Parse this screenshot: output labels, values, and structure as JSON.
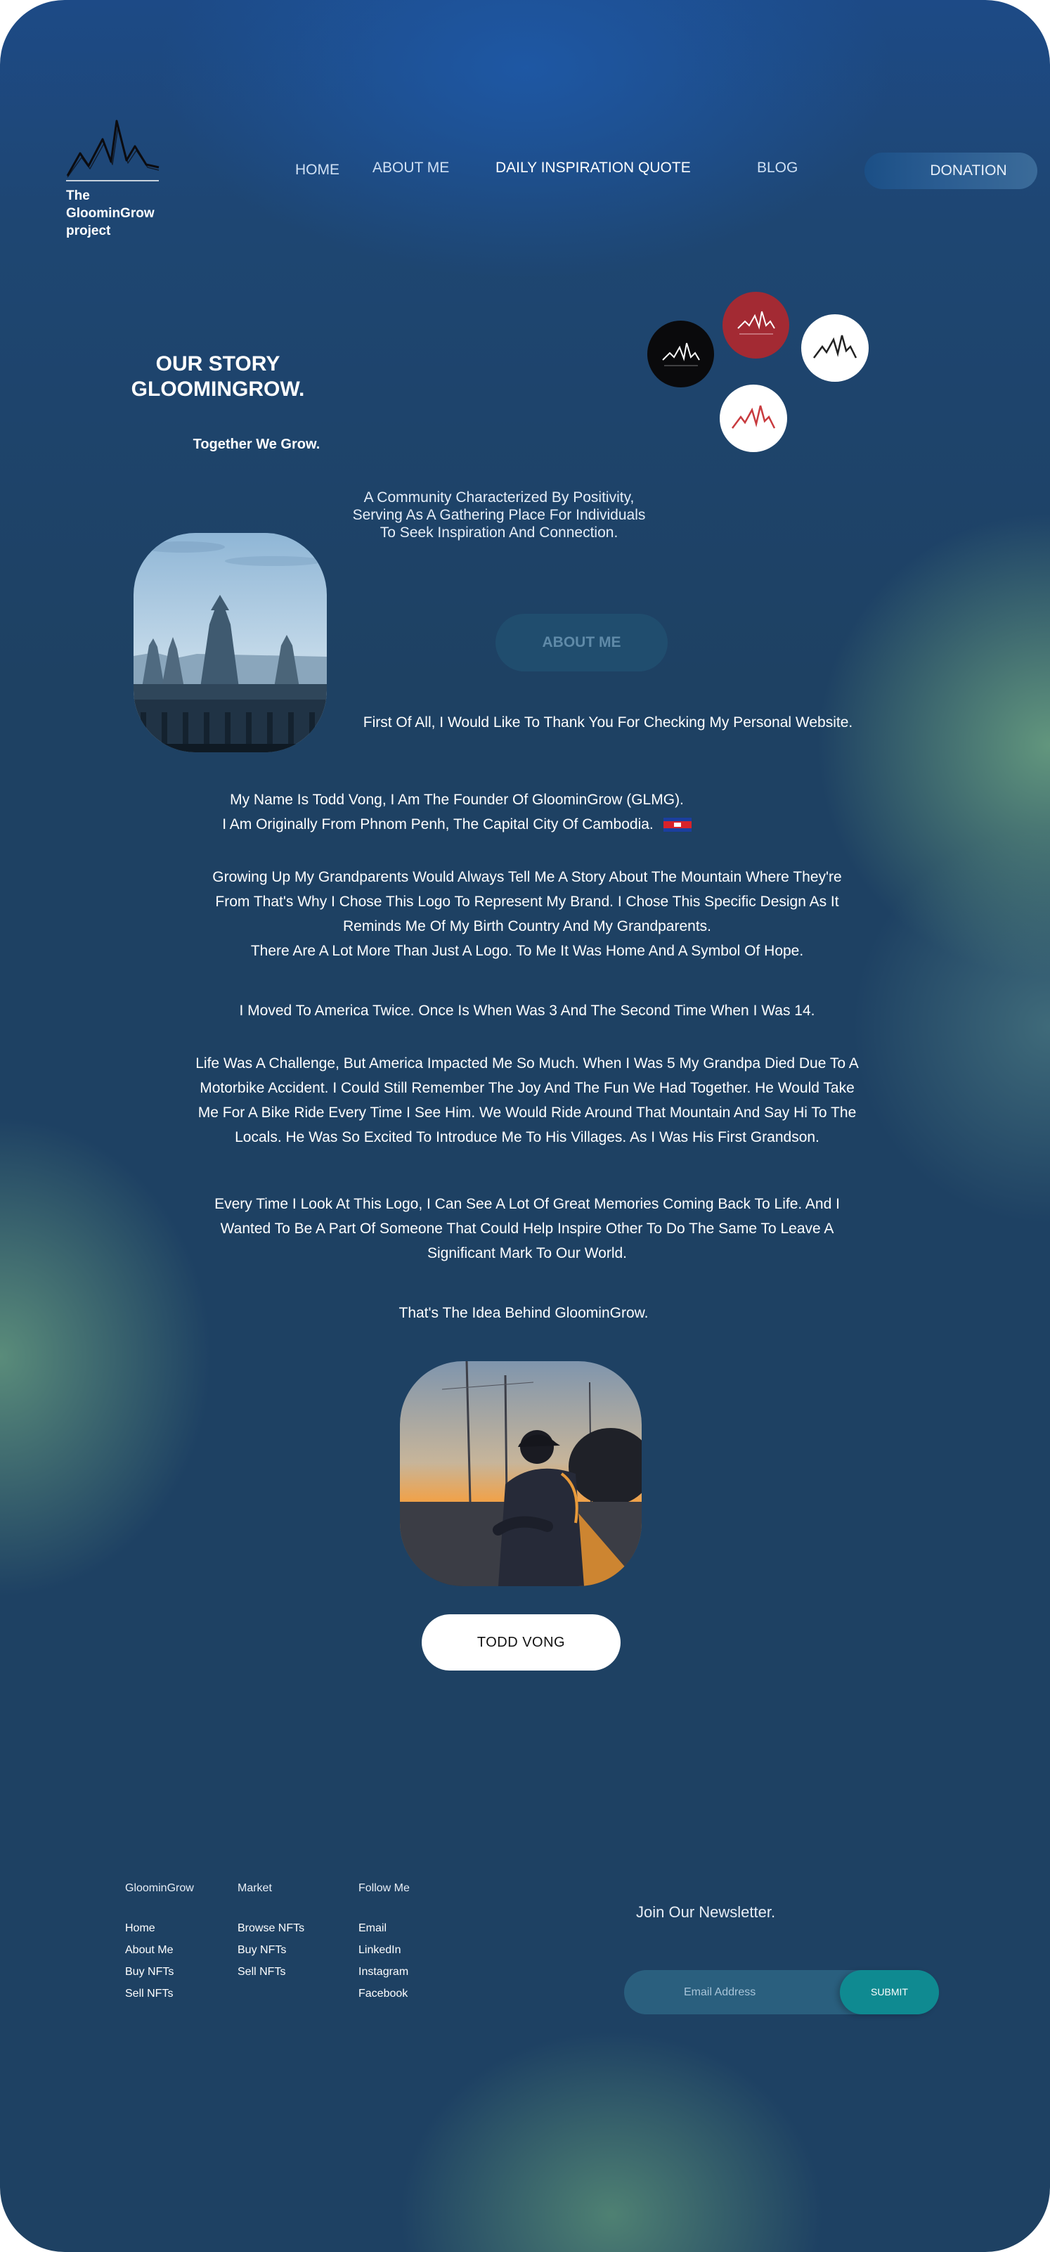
{
  "brand": {
    "logo_text": "The GloominGrow project",
    "logo_icon": "mountain-icon"
  },
  "nav": {
    "home": "HOME",
    "about": "ABOUT ME",
    "quote": "DAILY INSPIRATION QUOTE",
    "blog": "BLOG",
    "donation": "DONATION"
  },
  "hero": {
    "title_line1": "OUR STORY",
    "title_line2": "GLOOMINGROW.",
    "tagline": "Together We Grow.",
    "community_line1": "A Community Characterized By Positivity,",
    "community_line2": "Serving As A Gathering Place For Individuals",
    "community_line3": "To Seek Inspiration And Connection.",
    "about_button": "ABOUT ME"
  },
  "story": {
    "thanks": "First Of All, I Would Like To Thank You For Checking My Personal Website.",
    "name_line1": "My Name Is Todd Vong, I Am The Founder Of GloominGrow (GLMG).",
    "name_line2": "I Am Originally From Phnom Penh, The Capital City Of Cambodia.",
    "grow_line1": "Growing Up My Grandparents Would Always Tell Me A Story About The Mountain Where They're",
    "grow_line2": "From That's Why I Chose This Logo To Represent My Brand. I Chose This Specific Design As It",
    "grow_line3": "Reminds Me Of My Birth Country And My Grandparents.",
    "grow_line4": "There Are A Lot More Than Just A Logo. To Me It Was Home And A Symbol Of Hope.",
    "moved": "I Moved To America Twice. Once Is When Was 3 And The Second Time When I Was 14.",
    "life_line1": "Life Was A Challenge, But America Impacted Me So Much. When I Was 5 My Grandpa Died Due To A",
    "life_line2": "Motorbike Accident. I Could Still Remember The Joy And The Fun We Had Together. He Would Take",
    "life_line3": "Me For A Bike Ride Every Time I See Him. We Would Ride Around That Mountain And Say Hi To The",
    "life_line4": "Locals. He Was So Excited To Introduce Me To His Villages. As I Was His First Grandson.",
    "every_line1": "Every Time I Look At This Logo, I Can See A Lot Of Great Memories Coming Back To Life. And I",
    "every_line2": "Wanted To Be A Part Of Someone That Could Help Inspire Other To Do The Same To Leave A",
    "every_line3": "Significant Mark To Our World.",
    "idea": "That's The Idea Behind GloominGrow.",
    "name_button": "TODD VONG"
  },
  "footer": {
    "col1": {
      "heading": "GloominGrow",
      "links": [
        "Home",
        "About Me",
        "Buy NFTs",
        "Sell NFTs"
      ]
    },
    "col2": {
      "heading": "Market",
      "links": [
        "Browse NFTs",
        "Buy NFTs",
        "Sell NFTs"
      ]
    },
    "col3": {
      "heading": "Follow Me",
      "links": [
        "Email",
        "LinkedIn",
        "Instagram",
        "Facebook"
      ]
    },
    "newsletter": "Join Our Newsletter.",
    "email_placeholder": "Email Address",
    "submit": "SUBMIT"
  },
  "colors": {
    "background": "#1e4163",
    "accent_teal": "#0f8a91",
    "brand_red": "#a32a33"
  }
}
